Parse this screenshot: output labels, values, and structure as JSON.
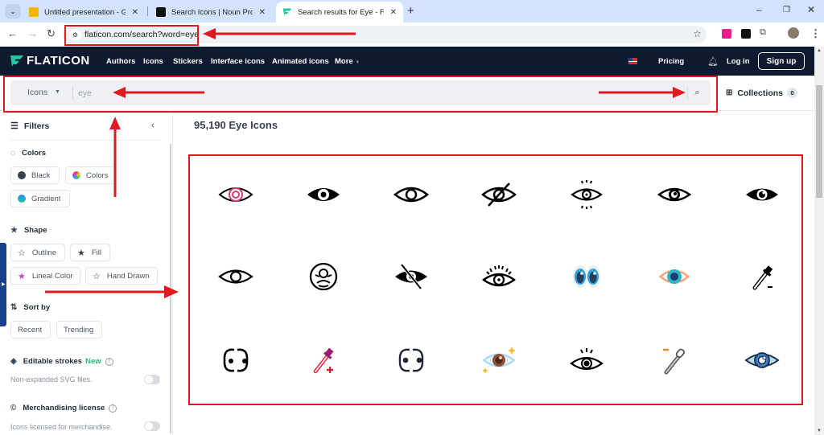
{
  "browser": {
    "tabs": [
      {
        "title": "Untitled presentation - Google",
        "favicon": "google-slides-icon",
        "active": false
      },
      {
        "title": "Search Icons | Noun Project",
        "favicon": "noun-project-icon",
        "active": false
      },
      {
        "title": "Search results for Eye - Flaticon",
        "favicon": "flaticon-icon",
        "active": true
      }
    ],
    "url": "flaticon.com/search?word=eye"
  },
  "header": {
    "logo_text": "FLATICON",
    "nav": [
      "Authors",
      "Icons",
      "Stickers",
      "Interface icons",
      "Animated icons",
      "More"
    ],
    "pricing": "Pricing",
    "login": "Log in",
    "signup": "Sign up"
  },
  "search": {
    "type_selected": "Icons",
    "query": "eye",
    "collections_label": "Collections",
    "collections_count": "0"
  },
  "sidebar": {
    "filters_label": "Filters",
    "colors": {
      "title": "Colors",
      "options": [
        "Black",
        "Colors",
        "Gradient"
      ]
    },
    "shape": {
      "title": "Shape",
      "options": [
        "Outline",
        "Fill",
        "Lineal Color",
        "Hand Drawn"
      ]
    },
    "sort": {
      "title": "Sort by",
      "options": [
        "Recent",
        "Trending"
      ]
    },
    "editable_strokes": {
      "title": "Editable strokes",
      "badge": "New",
      "desc": "Non-expanded SVG files.",
      "enabled": false
    },
    "merch": {
      "title": "Merchandising license",
      "desc": "Icons licensed for merchandise.",
      "enabled": false
    }
  },
  "results": {
    "title": "95,190 Eye Icons",
    "icons": [
      "eye-fingerprint-icon",
      "eye-filled-icon",
      "eye-outline-icon",
      "eye-slash-outline-icon",
      "eye-radiant-icon",
      "eye-outline-pupil-icon",
      "eye-filled-pupil-icon",
      "eye-outline-thin-icon",
      "iris-circle-icon",
      "eye-slash-filled-icon",
      "eye-lashes-icon",
      "cartoon-eyes-color-icon",
      "eye-orange-color-icon",
      "eyedropper-minus-icon",
      "cartoon-eyes-outline-icon",
      "eyedropper-plus-pink-icon",
      "cartoon-eyes-dark-icon",
      "eye-sparkle-icon",
      "eye-lashes-dot-icon",
      "eyedropper-minus-orange-icon",
      "eye-blue-icon"
    ]
  },
  "colors": {
    "header_bg": "#0e1a2f",
    "annotation_red": "#e0191f",
    "brand_teal": "#1fc9a6"
  }
}
